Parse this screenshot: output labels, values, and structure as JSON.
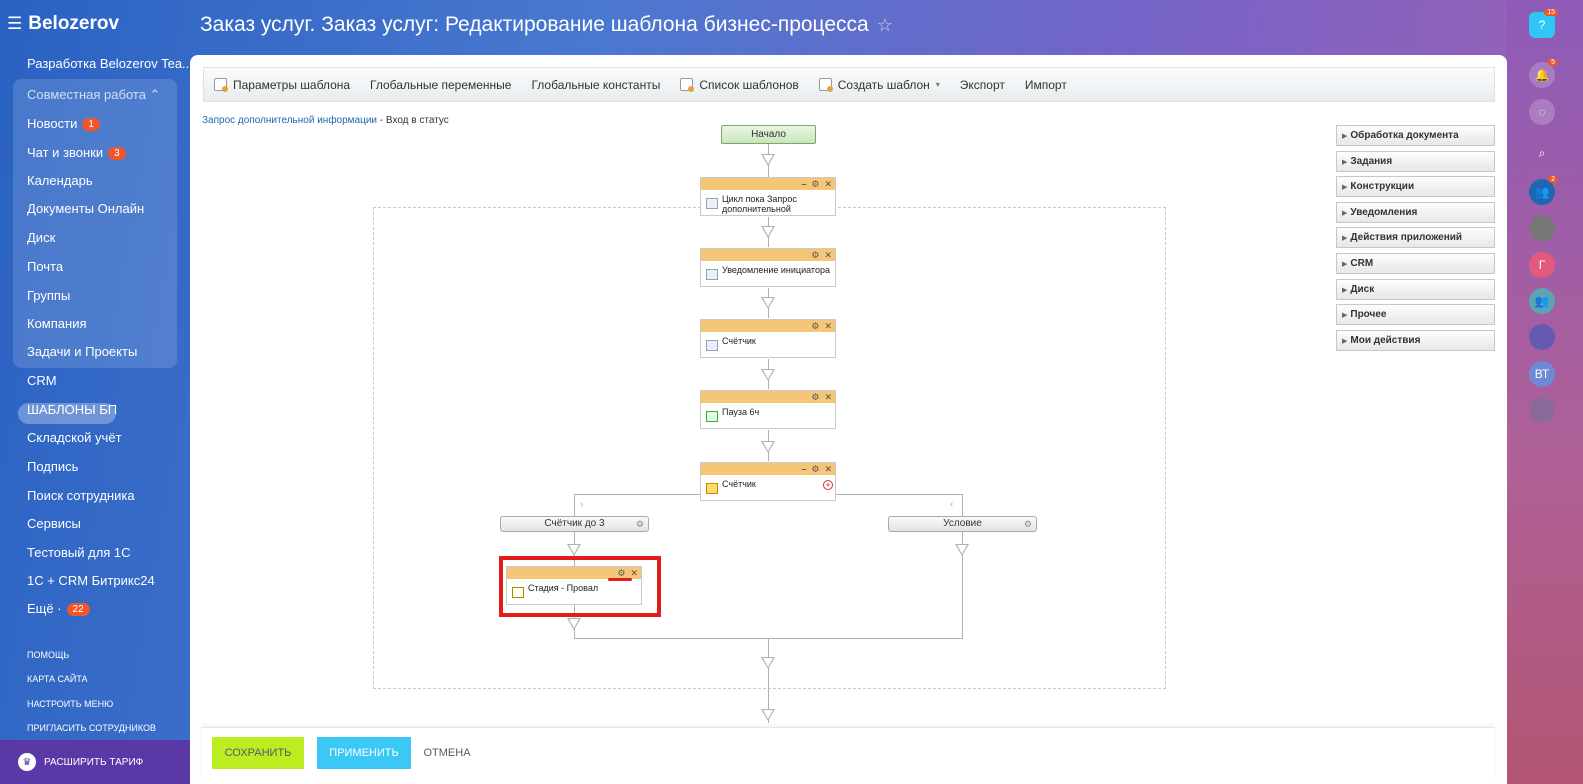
{
  "app": {
    "logo": "Belozerov"
  },
  "page": {
    "title": "Заказ услуг. Заказ услуг: Редактирование шаблона бизнес-процесса",
    "star": "☆"
  },
  "sidebar": {
    "top_item": "Разработка Belozerov Tea...",
    "group_label": "Совместная работа ⌃",
    "group_items": [
      {
        "label": "Новости",
        "badge": "1"
      },
      {
        "label": "Чат и звонки",
        "badge": "3"
      },
      {
        "label": "Календарь"
      },
      {
        "label": "Документы Онлайн"
      },
      {
        "label": "Диск"
      },
      {
        "label": "Почта"
      },
      {
        "label": "Группы"
      },
      {
        "label": "Компания"
      },
      {
        "label": "Задачи и Проекты"
      }
    ],
    "items": [
      {
        "label": "CRM"
      },
      {
        "label": "ШАБЛОНЫ БП",
        "active": true
      },
      {
        "label": "Складской учёт"
      },
      {
        "label": "Подпись"
      },
      {
        "label": "Поиск сотрудника"
      },
      {
        "label": "Сервисы"
      },
      {
        "label": "Тестовый для 1С"
      },
      {
        "label": "1С + CRM Битрикс24"
      },
      {
        "label": "Ещё ·",
        "badge": "22"
      }
    ],
    "links": [
      "ПОМОЩЬ",
      "КАРТА САЙТА",
      "НАСТРОИТЬ МЕНЮ",
      "ПРИГЛАСИТЬ СОТРУДНИКОВ"
    ],
    "upgrade": "РАСШИРИТЬ ТАРИФ"
  },
  "toolbar": {
    "params": "Параметры шаблона",
    "globals": "Глобальные переменные",
    "constants": "Глобальные константы",
    "list": "Список шаблонов",
    "create": "Создать шаблон",
    "export": "Экспорт",
    "import": "Импорт"
  },
  "breadcrumb": {
    "link": "Запрос дополнительной информации",
    "sep": " - ",
    "current": "Вход в статус"
  },
  "workflow": {
    "start": "Начало",
    "loop": "Цикл пока Запрос дополнительной",
    "notify": "Уведомление инициатора",
    "counter1": "Счётчик",
    "pause": "Пауза 6ч",
    "condition": "Счётчик",
    "branch_left": "Счётчик до 3",
    "branch_right": "Условие",
    "stage": "Стадия - Провал"
  },
  "palette": [
    "Обработка документа",
    "Задания",
    "Конструкции",
    "Уведомления",
    "Действия приложений",
    "CRM",
    "Диск",
    "Прочее",
    "Мои действия"
  ],
  "footer": {
    "save": "СОХРАНИТЬ",
    "apply": "ПРИМЕНИТЬ",
    "cancel": "ОТМЕНА"
  },
  "rightbar": {
    "help_badge": "15",
    "bell_badge": "5",
    "group_badge": "2",
    "avatar_letters": [
      "Г",
      "ВТ"
    ]
  },
  "colors": {
    "highlight": "#e21b1b",
    "save": "#bbed21",
    "apply": "#3bc8f5",
    "node_header": "#f5c678"
  }
}
